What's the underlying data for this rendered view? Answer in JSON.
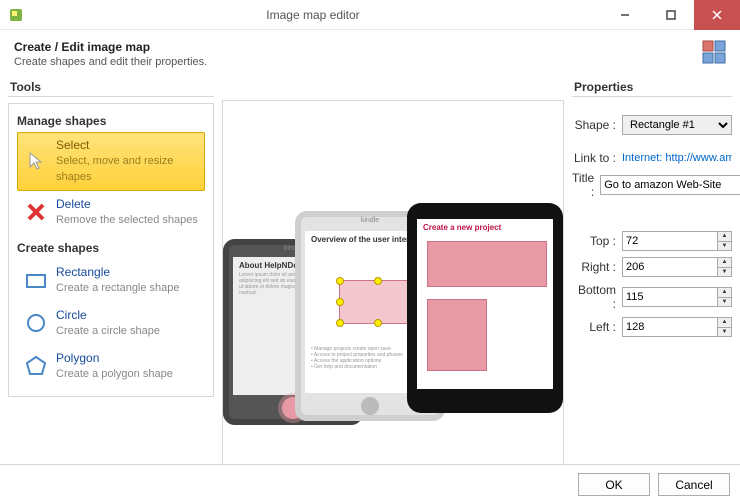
{
  "window": {
    "title": "Image map editor"
  },
  "header": {
    "title": "Create / Edit image map",
    "subtitle": "Create shapes and edit their properties."
  },
  "tools": {
    "panel_title": "Tools",
    "manage_section": "Manage shapes",
    "create_section": "Create shapes",
    "select": {
      "label": "Select",
      "desc": "Select, move and resize shapes"
    },
    "delete": {
      "label": "Delete",
      "desc": "Remove the selected shapes"
    },
    "rect": {
      "label": "Rectangle",
      "desc": "Create a rectangle shape"
    },
    "circle": {
      "label": "Circle",
      "desc": "Create a circle shape"
    },
    "polygon": {
      "label": "Polygon",
      "desc": "Create a polygon shape"
    }
  },
  "preview": {
    "dev1_headline": "About HelpNDoc",
    "dev2_headline": "Overview of the user interface",
    "dev3_headline": "Create a new project",
    "kindle": "kindle"
  },
  "props": {
    "panel_title": "Properties",
    "shape_label": "Shape :",
    "shape_value": "Rectangle #1",
    "linkto_label": "Link to :",
    "linkto_value": "Internet: http://www.amaz",
    "title_label": "Title :",
    "title_value": "Go to amazon Web-Site",
    "top_label": "Top :",
    "right_label": "Right :",
    "bottom_label": "Bottom :",
    "left_label": "Left :",
    "top": "72",
    "right": "206",
    "bottom": "115",
    "left": "128"
  },
  "footer": {
    "ok": "OK",
    "cancel": "Cancel"
  }
}
